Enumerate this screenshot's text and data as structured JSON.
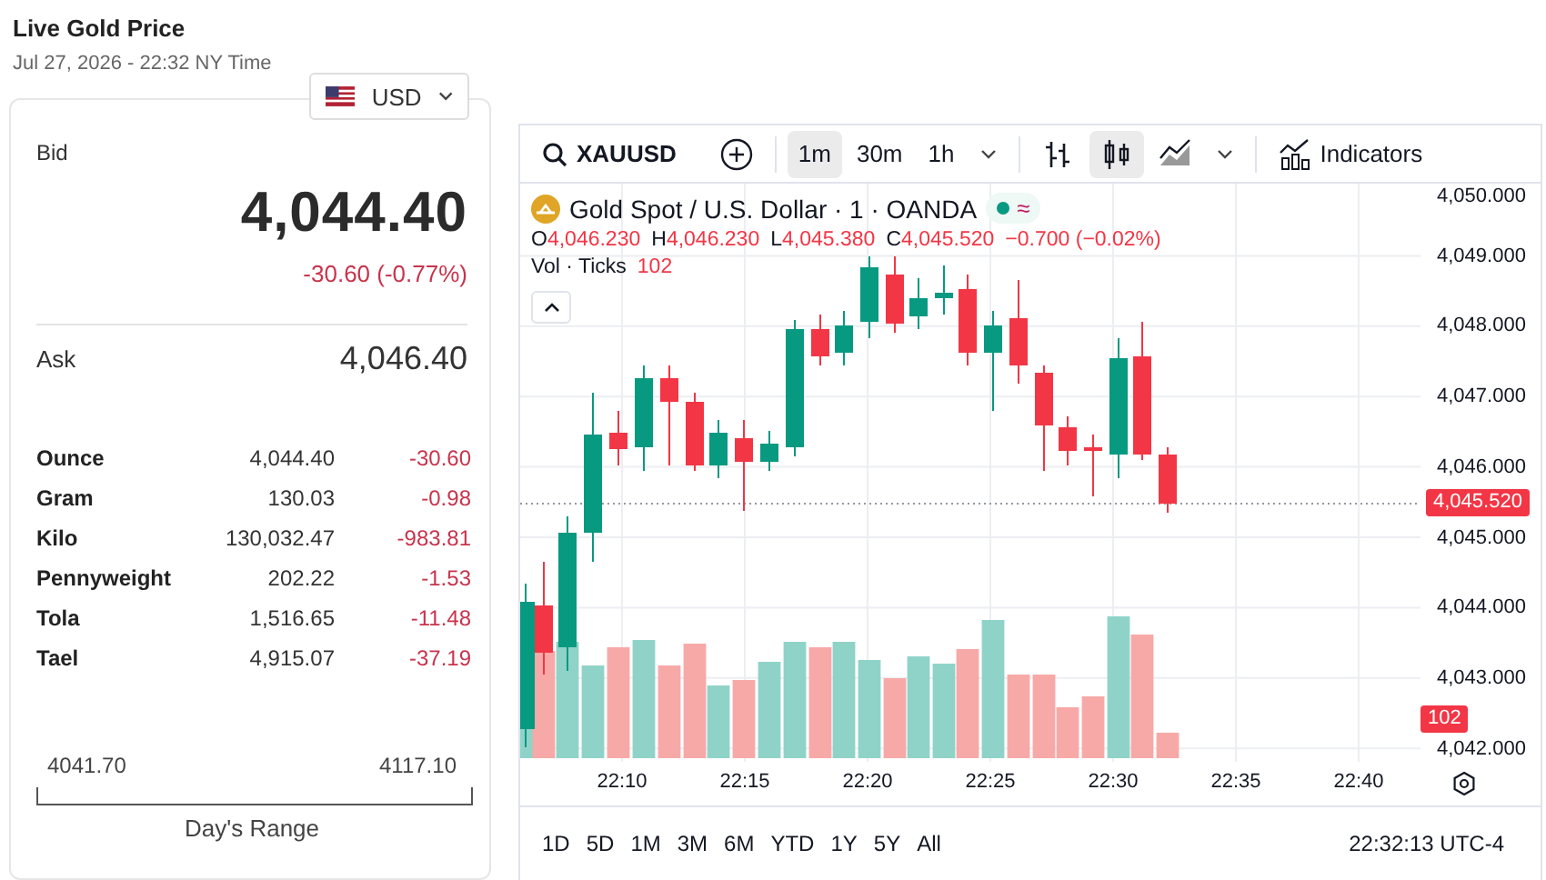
{
  "header": {
    "title": "Live Gold Price",
    "timestamp": "Jul 27, 2026 - 22:32 NY Time"
  },
  "currency": {
    "code": "USD"
  },
  "quote": {
    "bid_label": "Bid",
    "bid": "4,044.40",
    "change": "-30.60 (-0.77%)",
    "ask_label": "Ask",
    "ask": "4,046.40"
  },
  "units": [
    {
      "name": "Ounce",
      "price": "4,044.40",
      "change": "-30.60"
    },
    {
      "name": "Gram",
      "price": "130.03",
      "change": "-0.98"
    },
    {
      "name": "Kilo",
      "price": "130,032.47",
      "change": "-983.81"
    },
    {
      "name": "Pennyweight",
      "price": "202.22",
      "change": "-1.53"
    },
    {
      "name": "Tola",
      "price": "1,516.65",
      "change": "-11.48"
    },
    {
      "name": "Tael",
      "price": "4,915.07",
      "change": "-37.19"
    }
  ],
  "day_range": {
    "low": "4041.70",
    "high": "4117.10",
    "label": "Day's Range"
  },
  "chart": {
    "symbol": "XAUUSD",
    "intervals": [
      {
        "label": "1m",
        "selected": true
      },
      {
        "label": "30m",
        "selected": false
      },
      {
        "label": "1h",
        "selected": false
      }
    ],
    "chart_types": [
      {
        "kind": "bars",
        "selected": false
      },
      {
        "kind": "candles",
        "selected": true
      },
      {
        "kind": "area",
        "selected": false
      }
    ],
    "indicators_label": "Indicators",
    "title": "Gold Spot / U.S. Dollar · 1 · OANDA",
    "status_symbol": "≈",
    "ohlc": [
      {
        "key": "O",
        "value": "4,046.230"
      },
      {
        "key": "H",
        "value": "4,046.230"
      },
      {
        "key": "L",
        "value": "4,045.380"
      },
      {
        "key": "C",
        "value": "4,045.520"
      }
    ],
    "change": "−0.700 (−0.02%)",
    "volume_label": "Vol · Ticks",
    "volume": "102",
    "y_ticks": [
      "4,050.000",
      "4,049.000",
      "4,048.000",
      "4,047.000",
      "4,046.000",
      "4,045.000",
      "4,044.000",
      "4,043.000",
      "4,042.000"
    ],
    "price_tag": "4,045.520",
    "volume_tag": "102",
    "x_ticks": [
      "22:10",
      "22:15",
      "22:20",
      "22:25",
      "22:30",
      "22:35",
      "22:40"
    ],
    "ranges": [
      "1D",
      "5D",
      "1M",
      "3M",
      "6M",
      "YTD",
      "1Y",
      "5Y",
      "All"
    ],
    "clock": "22:32:13 UTC-4"
  }
}
